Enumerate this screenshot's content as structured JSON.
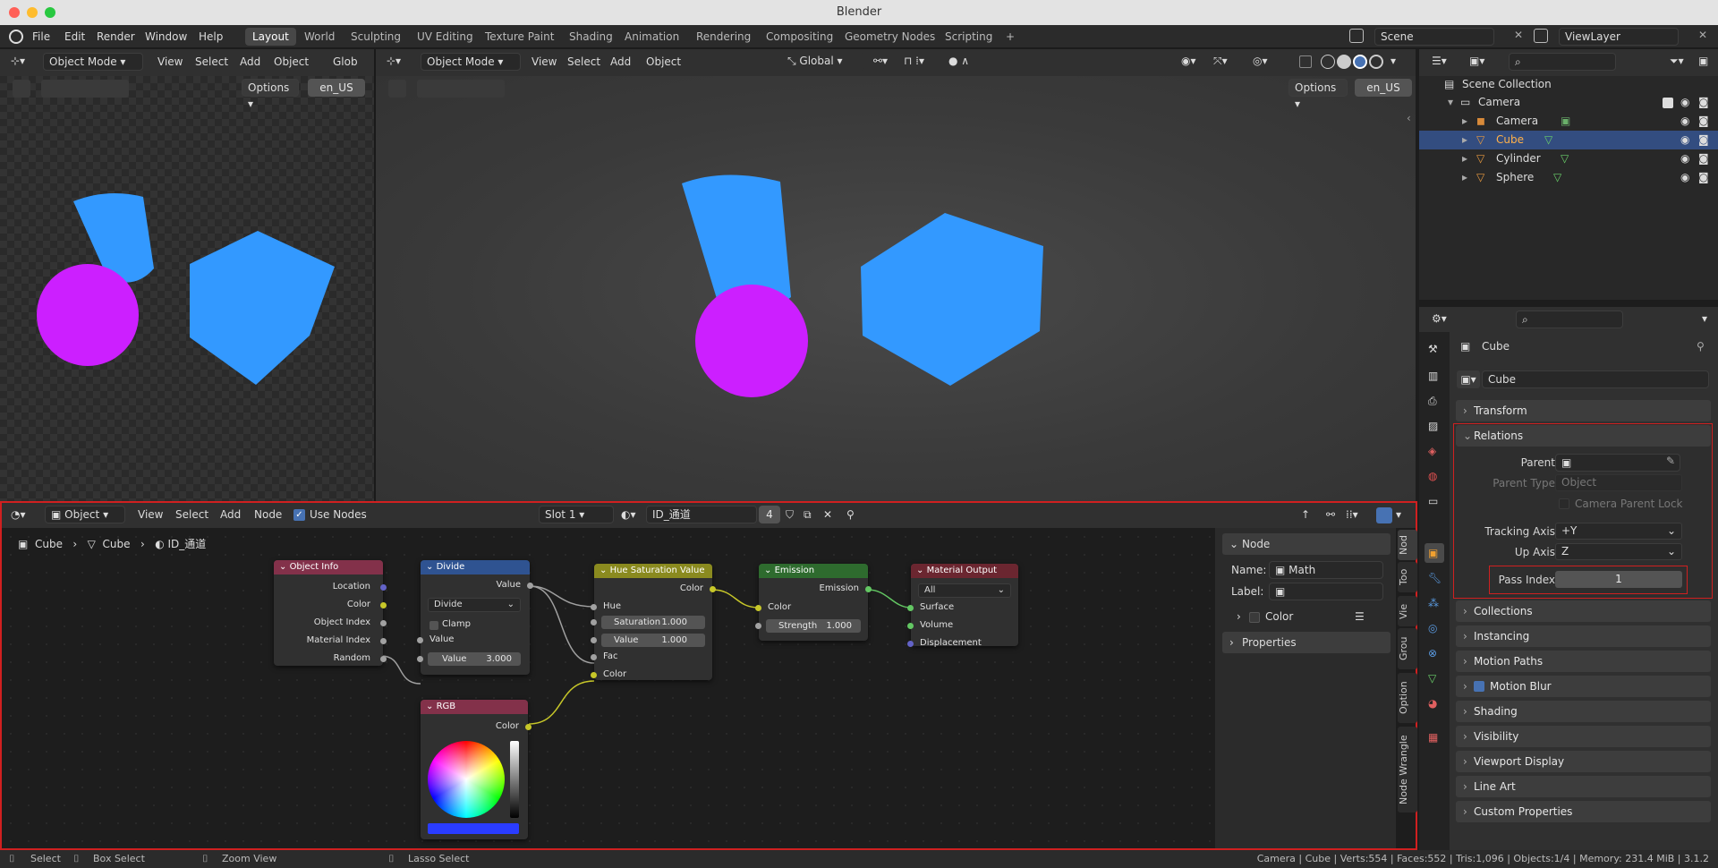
{
  "window": {
    "title": "Blender"
  },
  "menubar": {
    "items": [
      "File",
      "Edit",
      "Render",
      "Window",
      "Help"
    ]
  },
  "workspaces": [
    "Layout",
    "World",
    "Sculpting",
    "UV Editing",
    "Texture Paint",
    "Shading",
    "Animation",
    "Rendering",
    "Compositing",
    "Geometry Nodes",
    "Scripting"
  ],
  "workspace_add": "+",
  "scene": {
    "name": "Scene",
    "view_layer": "ViewLayer"
  },
  "viewport_left": {
    "mode": "Object Mode",
    "menus": [
      "View",
      "Select",
      "Add",
      "Object"
    ],
    "transform": "Glob",
    "options": "Options",
    "lang": "en_US"
  },
  "viewport_main": {
    "mode": "Object Mode",
    "menus": [
      "View",
      "Select",
      "Add",
      "Object"
    ],
    "transform": "Global",
    "options": "Options",
    "lang": "en_US"
  },
  "node_editor": {
    "header": {
      "type": "Object",
      "menus": [
        "View",
        "Select",
        "Add",
        "Node"
      ],
      "use_nodes": "Use Nodes",
      "slot": "Slot 1",
      "material": "ID_通道",
      "users": "4"
    },
    "breadcrumb": [
      "Cube",
      "Cube",
      "ID_通道"
    ],
    "nodes": {
      "object_info": {
        "title": "Object Info",
        "outputs": [
          "Location",
          "Color",
          "Object Index",
          "Material Index",
          "Random"
        ]
      },
      "divide": {
        "title": "Divide",
        "output": "Value",
        "operation": "Divide",
        "clamp": "Clamp",
        "input": "Value",
        "value_label": "Value",
        "value": "3.000"
      },
      "hsv": {
        "title": "Hue Saturation Value",
        "output": "Color",
        "hue": "Hue",
        "saturation_label": "Saturation",
        "saturation": "1.000",
        "value_label": "Value",
        "value": "1.000",
        "fac": "Fac",
        "color": "Color"
      },
      "emission": {
        "title": "Emission",
        "output": "Emission",
        "color": "Color",
        "strength_label": "Strength",
        "strength": "1.000"
      },
      "material_output": {
        "title": "Material Output",
        "target": "All",
        "inputs": [
          "Surface",
          "Volume",
          "Displacement"
        ]
      },
      "rgb": {
        "title": "RGB",
        "output": "Color",
        "swatch_color": "#2a3cff"
      }
    },
    "sidebar": {
      "node_header": "Node",
      "name_label": "Name:",
      "name_value": "Math",
      "label_label": "Label:",
      "color_label": "Color",
      "properties": "Properties"
    },
    "vtabs": [
      "Nod",
      "Too",
      "Vie",
      "Grou",
      "Option",
      "Node Wrangle"
    ]
  },
  "outliner": {
    "root": "Scene Collection",
    "collection": "Camera",
    "items": [
      {
        "name": "Camera",
        "selected": false
      },
      {
        "name": "Cube",
        "selected": true
      },
      {
        "name": "Cylinder",
        "selected": false
      },
      {
        "name": "Sphere",
        "selected": false
      }
    ]
  },
  "properties": {
    "object_name": "Cube",
    "data_name": "Cube",
    "sections_top": [
      "Transform"
    ],
    "relations": {
      "title": "Relations",
      "parent_label": "Parent",
      "parent_type_label": "Parent Type",
      "parent_type_value": "Object",
      "camera_parent_lock": "Camera Parent Lock",
      "tracking_axis_label": "Tracking Axis",
      "tracking_axis": "+Y",
      "up_axis_label": "Up Axis",
      "up_axis": "Z",
      "pass_index_label": "Pass Index",
      "pass_index": "1"
    },
    "sections": [
      "Collections",
      "Instancing",
      "Motion Paths",
      "Motion Blur",
      "Shading",
      "Visibility",
      "Viewport Display",
      "Line Art",
      "Custom Properties"
    ]
  },
  "statusbar": {
    "select": "Select",
    "box_select": "Box Select",
    "zoom_view": "Zoom View",
    "lasso_select": "Lasso Select",
    "info": "Camera | Cube | Verts:554 | Faces:552 | Tris:1,096 | Objects:1/4 | Memory: 231.4 MiB | 3.1.2"
  },
  "colors": {
    "accent": "#4772b3",
    "highlight": "#e03030",
    "magenta": "#cc1fff",
    "blue": "#3399ff"
  }
}
